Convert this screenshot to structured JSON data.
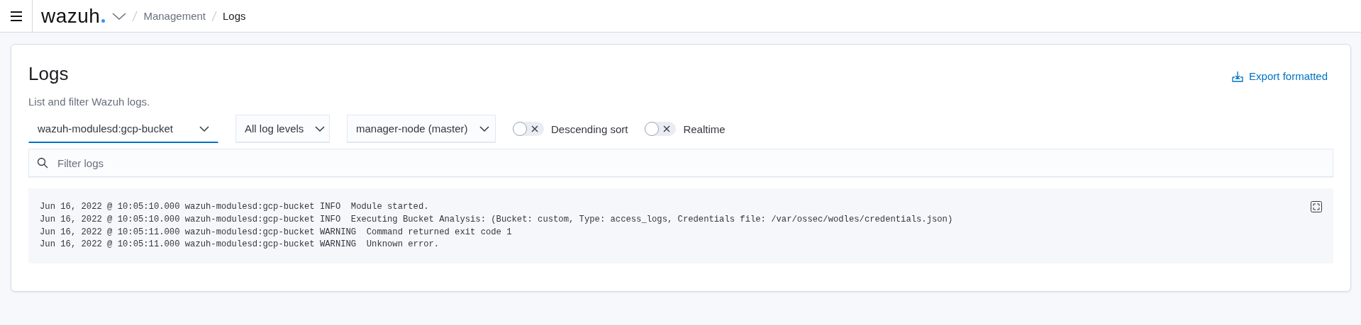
{
  "header": {
    "logo": "wazuh",
    "breadcrumbs": [
      {
        "label": "Management",
        "current": false
      },
      {
        "label": "Logs",
        "current": true
      }
    ]
  },
  "page": {
    "title": "Logs",
    "description": "List and filter Wazuh logs.",
    "export_label": "Export formatted"
  },
  "filters": {
    "selects": [
      {
        "value": "wazuh-modulesd:gcp-bucket",
        "focused": true
      },
      {
        "value": "All log levels",
        "focused": false
      },
      {
        "value": "manager-node (master)",
        "focused": false
      }
    ],
    "toggles": [
      {
        "label": "Descending sort",
        "on": false
      },
      {
        "label": "Realtime",
        "on": false
      }
    ],
    "search": {
      "placeholder": "Filter logs"
    }
  },
  "log_lines": [
    "Jun 16, 2022 @ 10:05:10.000 wazuh-modulesd:gcp-bucket INFO  Module started.",
    "Jun 16, 2022 @ 10:05:10.000 wazuh-modulesd:gcp-bucket INFO  Executing Bucket Analysis: (Bucket: custom, Type: access_logs, Credentials file: /var/ossec/wodles/credentials.json)",
    "Jun 16, 2022 @ 10:05:11.000 wazuh-modulesd:gcp-bucket WARNING  Command returned exit code 1",
    "Jun 16, 2022 @ 10:05:11.000 wazuh-modulesd:gcp-bucket WARNING  Unknown error."
  ]
}
